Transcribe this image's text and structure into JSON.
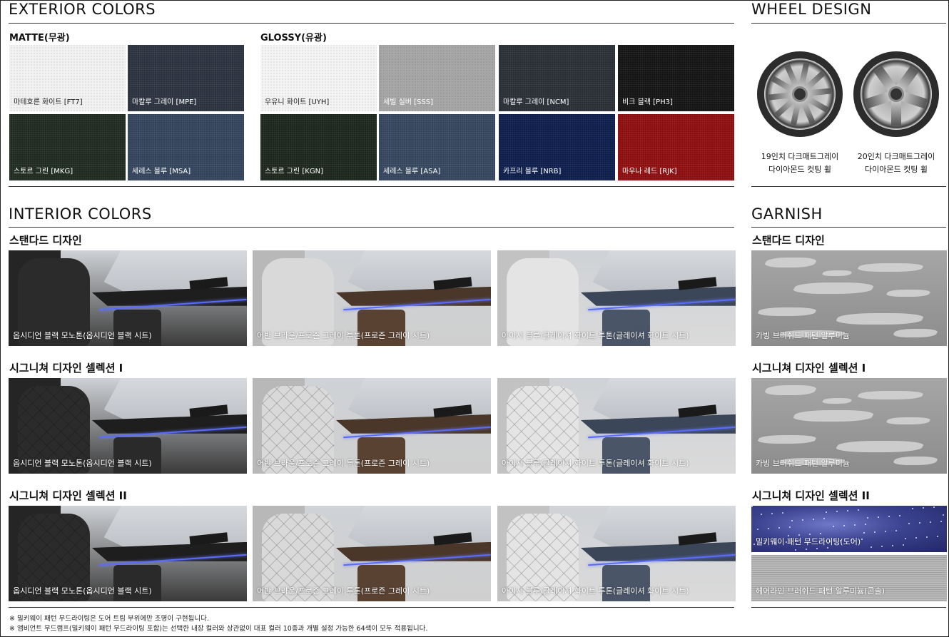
{
  "exterior": {
    "title": "EXTERIOR COLORS",
    "matte_label": "MATTE(무광)",
    "glossy_label": "GLOSSY(유광)",
    "matte": [
      {
        "name": "마테호른 화이트 [FT7]",
        "color": "#f1f1f1",
        "text_color": "#222"
      },
      {
        "name": "마칼루 그레이 [MPE]",
        "color": "#2c3340",
        "text_color": "#fff"
      },
      {
        "name": "스토르 그린 [MKG]",
        "color": "#1f2a20",
        "text_color": "#fff"
      },
      {
        "name": "세레스 블루 [MSA]",
        "color": "#33445c",
        "text_color": "#fff"
      }
    ],
    "glossy": [
      {
        "name": "우유니 화이트 [UYH]",
        "color": "#f3f3f3",
        "text_color": "#222"
      },
      {
        "name": "세빌 실버 [SSS]",
        "color": "#a4a4a4",
        "text_color": "#fff"
      },
      {
        "name": "마칼루 그레이 [NCM]",
        "color": "#2a2e36",
        "text_color": "#fff"
      },
      {
        "name": "비크 블랙 [PH3]",
        "color": "#141414",
        "text_color": "#fff"
      },
      {
        "name": "스토르 그린 [KGN]",
        "color": "#1c261d",
        "text_color": "#fff"
      },
      {
        "name": "세레스 블루 [ASA]",
        "color": "#35465e",
        "text_color": "#fff"
      },
      {
        "name": "카프리 블루 [NRB]",
        "color": "#0e1e4c",
        "text_color": "#fff"
      },
      {
        "name": "마우나 레드 [RJK]",
        "color": "#8e0e10",
        "text_color": "#fff"
      }
    ]
  },
  "wheel": {
    "title": "WHEEL DESIGN",
    "items": [
      {
        "line1": "19인치 다크매트그레이",
        "line2": "다이아몬드 컷팅 휠"
      },
      {
        "line1": "20인치 다크매트그레이",
        "line2": "다이아몬드 컷팅 휠"
      }
    ]
  },
  "interior": {
    "title": "INTERIOR COLORS",
    "rows": [
      {
        "heading": "스탠다드 디자인",
        "quilted": false
      },
      {
        "heading": "시그니쳐 디자인 셀렉션 I",
        "quilted": true
      },
      {
        "heading": "시그니쳐 디자인 셀렉션 II",
        "quilted": true
      }
    ],
    "options": [
      {
        "name": "옵시디언 블랙 모노톤(옵시디언 블랙 시트)",
        "seat": "#2b2b2b",
        "dash": "#1e1e1e",
        "floor": "#3a3a3a",
        "trim": "#2a2a2a"
      },
      {
        "name": "어반 브라운/프로즌 그레이 투톤(프로즌 그레이 시트)",
        "seat": "#d9d9d9",
        "dash": "#4a372a",
        "floor": "#cfcfcf",
        "trim": "#5a4232"
      },
      {
        "name": "아이시 블루/글레이셔 화이트 투톤(글레이셔 화이트 시트)",
        "seat": "#e4e4e4",
        "dash": "#3b4658",
        "floor": "#dadada",
        "trim": "#4a5568"
      }
    ]
  },
  "garnish": {
    "title": "GARNISH",
    "rows": [
      {
        "heading": "스탠다드 디자인",
        "items": [
          {
            "name": "카빙 브러쉬드 패턴 알루미늄",
            "type": "carving"
          }
        ]
      },
      {
        "heading": "시그니쳐 디자인 셀렉션 I",
        "items": [
          {
            "name": "카빙 브러쉬드 패턴 알루미늄",
            "type": "carving"
          }
        ]
      },
      {
        "heading": "시그니쳐 디자인 셀렉션 II",
        "items": [
          {
            "name": "밀키웨이 패턴 무드라이팅(도어)",
            "type": "milky"
          },
          {
            "name": "헤어라인 브러쉬드 패턴 알루미늄(콘솔)",
            "type": "hairline"
          }
        ]
      }
    ]
  },
  "notes": [
    "※ 밀키웨이 패턴 무드라이팅은 도어 트림 부위에만 조명이 구현됩니다.",
    "※ 앰비언트 무드램프(밀키웨이 패턴 무드라이팅 포함)는 선택한 내장 컬러와 상관없이 대표 컬러 10종과 개별 설정 가능한 64색이 모두 적용됩니다."
  ]
}
